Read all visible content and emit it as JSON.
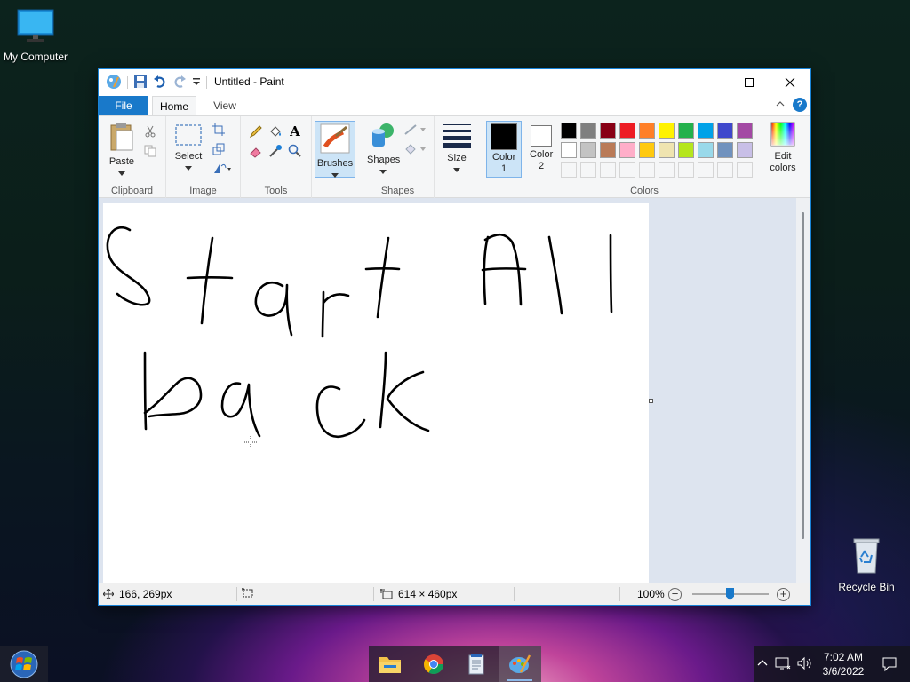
{
  "desktop": {
    "icons": [
      {
        "label": "My Computer"
      },
      {
        "label": "Recycle Bin"
      }
    ]
  },
  "window": {
    "title": "Untitled - Paint",
    "tabs": [
      {
        "label": "File"
      },
      {
        "label": "Home"
      },
      {
        "label": "View"
      }
    ],
    "ribbon": {
      "clipboard": {
        "paste": "Paste",
        "group": "Clipboard"
      },
      "image": {
        "select": "Select",
        "group": "Image"
      },
      "tools": {
        "group": "Tools"
      },
      "brushes": {
        "label": "Brushes"
      },
      "shapes": {
        "label": "Shapes",
        "group": "Shapes"
      },
      "size": {
        "label": "Size"
      },
      "color1": {
        "label": "Color 1",
        "value": "#000000"
      },
      "color2": {
        "label": "Color 2",
        "value": "#ffffff"
      },
      "edit_colors": "Edit colors",
      "colors_group": "Colors",
      "palette_row1": [
        "#000000",
        "#7f7f7f",
        "#880015",
        "#ed1c24",
        "#ff7f27",
        "#fff200",
        "#22b14c",
        "#00a2e8",
        "#3f48cc",
        "#a349a4"
      ],
      "palette_row2": [
        "#ffffff",
        "#c3c3c3",
        "#b97a57",
        "#ffaec9",
        "#ffc90e",
        "#efe4b0",
        "#b5e61d",
        "#99d9ea",
        "#7092be",
        "#c8bfe7"
      ]
    },
    "canvas": {
      "drawn_text_line1": "Start All",
      "drawn_text_line2": "back"
    },
    "status": {
      "cursor_position": "166, 269px",
      "image_size": "614 × 460px",
      "zoom": "100%"
    }
  },
  "taskbar": {
    "apps": [
      "File Explorer",
      "Google Chrome",
      "Notepad",
      "Paint"
    ],
    "time": "7:02 AM",
    "date": "3/6/2022"
  }
}
